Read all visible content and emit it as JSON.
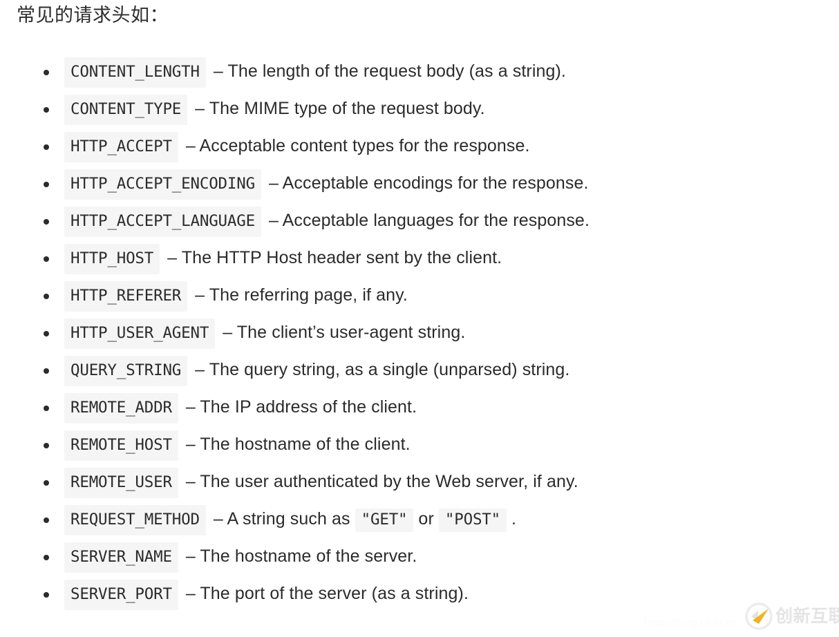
{
  "heading": "常见的请求头如：",
  "list": {
    "items": [
      {
        "code": "CONTENT_LENGTH",
        "dash": "– ",
        "desc": "The length of the request body (as a string)."
      },
      {
        "code": "CONTENT_TYPE",
        "dash": "– ",
        "desc": "The MIME type of the request body."
      },
      {
        "code": "HTTP_ACCEPT",
        "dash": "– ",
        "desc": "Acceptable content types for the response."
      },
      {
        "code": "HTTP_ACCEPT_ENCODING",
        "dash": "– ",
        "desc": "Acceptable encodings for the response."
      },
      {
        "code": "HTTP_ACCEPT_LANGUAGE",
        "dash": "– ",
        "desc": "Acceptable languages for the response."
      },
      {
        "code": "HTTP_HOST",
        "dash": "– ",
        "desc": "The HTTP Host header sent by the client."
      },
      {
        "code": "HTTP_REFERER",
        "dash": "– ",
        "desc": "The referring page, if any."
      },
      {
        "code": "HTTP_USER_AGENT",
        "dash": "– ",
        "desc": "The client’s user-agent string."
      },
      {
        "code": "QUERY_STRING",
        "dash": "– ",
        "desc": "The query string, as a single (unparsed) string."
      },
      {
        "code": "REMOTE_ADDR",
        "dash": "– ",
        "desc": "The IP address of the client."
      },
      {
        "code": "REMOTE_HOST",
        "dash": "– ",
        "desc": "The hostname of the client."
      },
      {
        "code": "REMOTE_USER",
        "dash": "– ",
        "desc": "The user authenticated by the Web server, if any."
      },
      {
        "code": "REQUEST_METHOD",
        "dash": "– ",
        "desc": "A string such as ",
        "desc_parts": [
          {
            "kind": "plain",
            "text": "– A string such as "
          },
          {
            "kind": "code",
            "text": "\"GET\""
          },
          {
            "kind": "plain",
            "text": " or "
          },
          {
            "kind": "code",
            "text": "\"POST\""
          },
          {
            "kind": "plain",
            "text": " ."
          }
        ]
      },
      {
        "code": "SERVER_NAME",
        "dash": "– ",
        "desc": "The hostname of the server."
      },
      {
        "code": "SERVER_PORT",
        "dash": "– ",
        "desc": "The port of the server (as a string)."
      }
    ]
  },
  "watermark": {
    "url_text": "https://blog.csdn.ne",
    "brand_text": "创新互联",
    "brand_icon": "brand-swoosh-icon",
    "brand_accent": "#f2b31c",
    "brand_gray": "#e4e4e4"
  },
  "colors": {
    "page_background": "#ffffff",
    "text": "#2b2b2b",
    "code_background": "#f5f5f5"
  }
}
